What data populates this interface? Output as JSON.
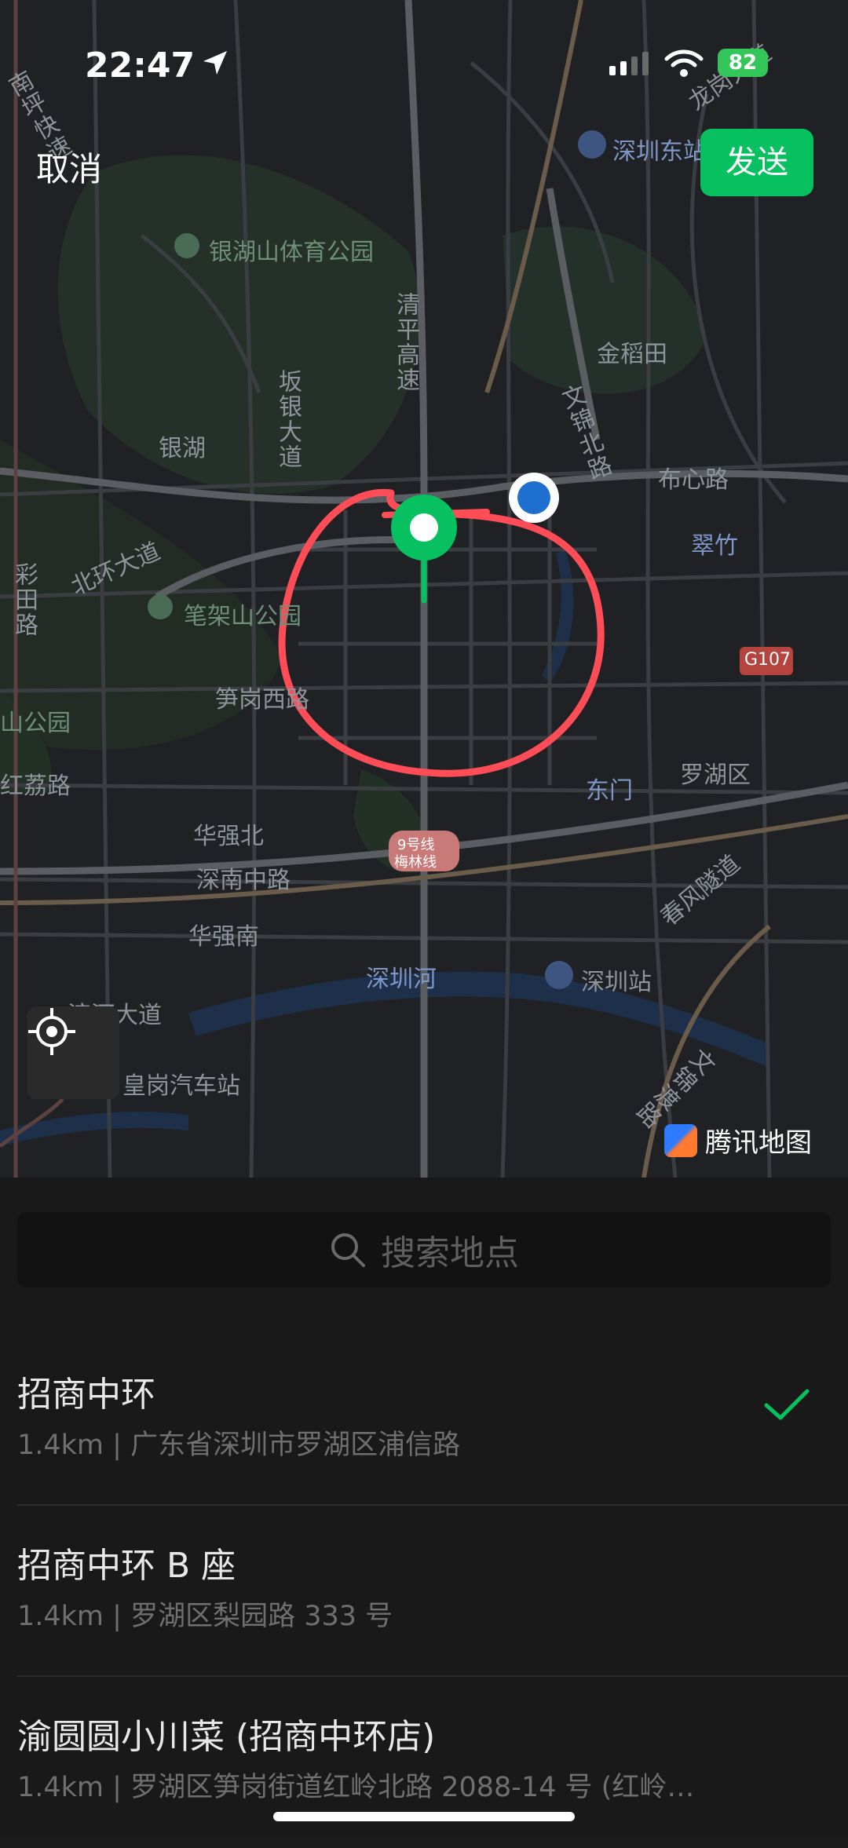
{
  "status_bar": {
    "time": "22:47",
    "battery": "82"
  },
  "header": {
    "cancel_label": "取消",
    "send_label": "发送"
  },
  "map": {
    "labels": {
      "nanping_expwy": "南坪快速",
      "longhua": "龙岗大道",
      "shenzhen_east": "深圳东站",
      "yinhushan_park": "银湖山体育公园",
      "qingping_expwy": "清平高速",
      "jindaotian": "金稻田",
      "bantian": "坂银大道",
      "yinhu": "银湖",
      "wenjin_north": "文锦北路",
      "buxin_road": "布心路",
      "beihuan": "北环大道",
      "cuizhu": "翠竹",
      "caitian": "彩田路",
      "bijiashan": "笔架山公园",
      "g107": "G107",
      "sungang_west": "笋岗西路",
      "lianhuashan": "山公园",
      "dongmen": "东门",
      "luohu_district": "罗湖区",
      "honglizhu": "红荔路",
      "huaqiangbei": "华强北",
      "metro_line9": "9号线",
      "meilin_line": "梅林线",
      "shennan_road": "深南中路",
      "chunfeng_tunnel": "春风隧道",
      "huaqiangnan": "华强南",
      "shenzhen_river": "深圳河",
      "shenzhen_station": "深圳站",
      "binhe": "滨河大道",
      "huanggang_bus": "皇岗汽车站",
      "wenjin_south": "文锦渡路"
    },
    "provider": "腾讯地图"
  },
  "search": {
    "placeholder": "搜索地点"
  },
  "results": [
    {
      "title": "招商中环",
      "subtitle": "1.4km | 广东省深圳市罗湖区浦信路",
      "selected": true
    },
    {
      "title": "招商中环 B 座",
      "subtitle": "1.4km | 罗湖区梨园路 333 号",
      "selected": false
    },
    {
      "title": "渝圆圆小川菜 (招商中环店)",
      "subtitle": "1.4km | 罗湖区笋岗街道红岭北路 2088-14 号 (红岭…",
      "selected": false
    }
  ],
  "colors": {
    "accent": "#07c160",
    "pin": "#07c160",
    "user_dot": "#1f6fd1",
    "annotation": "#ff4d57"
  }
}
